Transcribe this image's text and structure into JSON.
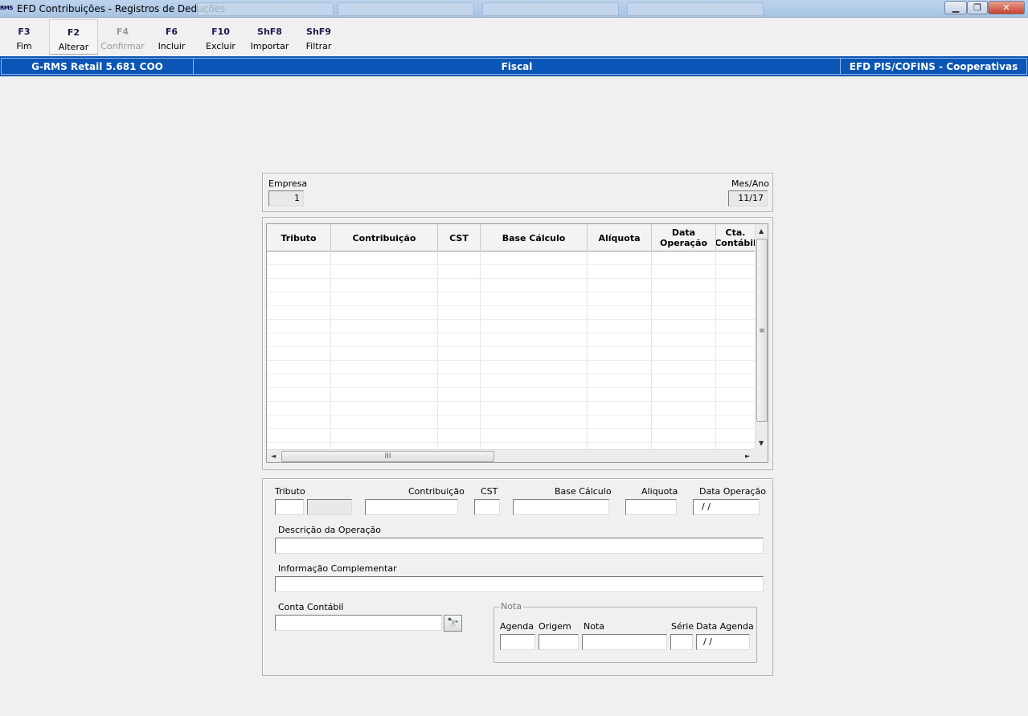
{
  "window": {
    "app_icon_text": "RMS",
    "title": "EFD Contribuições - Registros de Deduções",
    "minimize_glyph": "▁",
    "maximize_glyph": "❐",
    "close_glyph": "✕"
  },
  "toolbar": {
    "buttons": [
      {
        "key": "F3",
        "label": "Fim"
      },
      {
        "key": "F2",
        "label": "Alterar"
      },
      {
        "key": "F4",
        "label": "Confirmar"
      },
      {
        "key": "F6",
        "label": "Incluir"
      },
      {
        "key": "F10",
        "label": "Excluir"
      },
      {
        "key": "ShF8",
        "label": "Importar"
      },
      {
        "key": "ShF9",
        "label": "Filtrar"
      }
    ]
  },
  "statusbar": {
    "left": "G-RMS Retail 5.681 COO",
    "center": "Fiscal",
    "right": "EFD PIS/COFINS - Cooperativas"
  },
  "header_panel": {
    "empresa_label": "Empresa",
    "empresa_value": "1",
    "mesano_label": "Mes/Ano",
    "mesano_value": "11/17"
  },
  "grid": {
    "columns": [
      "Tributo",
      "Contribuição",
      "CST",
      "Base Cálculo",
      "Alíquota",
      "Data Operação",
      "Cta. Contábil"
    ],
    "vthumb_glyph": "≡",
    "hthumb_glyph": "III",
    "up_arrow": "▲",
    "down_arrow": "▼",
    "left_arrow": "◄",
    "right_arrow": "►"
  },
  "form": {
    "tributo_label": "Tributo",
    "contribuicao_label": "Contribuição",
    "cst_label": "CST",
    "base_label": "Base Cálculo",
    "aliquota_label": "Aliquota",
    "data_operacao_label": "Data Operação",
    "data_operacao_value": " / /",
    "descricao_label": "Descrição da Operação",
    "info_label": "Informação Complementar",
    "conta_label": "Conta Contábil",
    "lookup_glyph": "🔭",
    "nota": {
      "legend": "Nota",
      "agenda_label": "Agenda",
      "origem_label": "Origem",
      "nota_label": "Nota",
      "serie_label": "Série",
      "data_agenda_label": "Data Agenda",
      "data_agenda_value": " / /"
    }
  }
}
